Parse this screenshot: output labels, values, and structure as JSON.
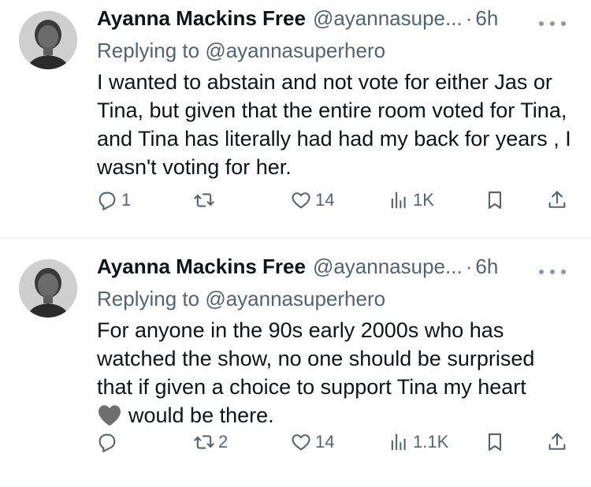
{
  "tweets": [
    {
      "name": "Ayanna Mackins Free",
      "handle": "@ayannasupe...",
      "dot": "·",
      "time": "6h",
      "replying_prefix": "Replying to",
      "replying_to": "@ayannasuperhero",
      "text": "I wanted to abstain and not vote for either Jas or Tina, but given that the entire room voted for Tina, and Tina has literally had had my back for years , I wasn't voting for her.",
      "replies": "1",
      "retweets": "",
      "likes": "14",
      "views": "1K"
    },
    {
      "name": "Ayanna Mackins Free",
      "handle": "@ayannasupe...",
      "dot": "·",
      "time": "6h",
      "replying_prefix": "Replying to",
      "replying_to": "@ayannasuperhero",
      "text_main": "For anyone in the 90s early 2000s who has watched the show, no one should be surprised that if given a choice to support Tina my heart",
      "text_after_emoji": "would be there.",
      "replies": "",
      "retweets": "2",
      "likes": "14",
      "views": "1.1K"
    }
  ],
  "icons": {
    "reply": "reply-icon",
    "retweet": "retweet-icon",
    "like": "heart-icon",
    "views": "views-icon",
    "bookmark": "bookmark-icon",
    "share": "share-icon",
    "more": "more-icon",
    "emoji": "heart-emoji-icon"
  },
  "colors": {
    "text": "#0f1419",
    "secondary": "#536471",
    "divider": "#eff3f4"
  }
}
